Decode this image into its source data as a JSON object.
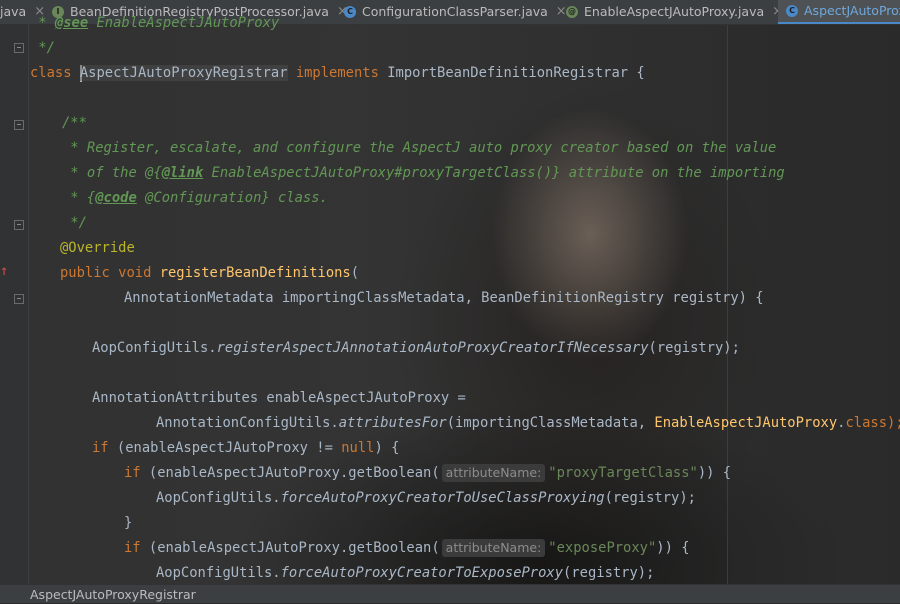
{
  "tabs": [
    {
      "label": "java",
      "icon": ""
    },
    {
      "label": "BeanDefinitionRegistryPostProcessor.java",
      "icon": "interface-icon",
      "icon_letter": "I",
      "icon_color": "#6a8759"
    },
    {
      "label": "ConfigurationClassParser.java",
      "icon": "class-icon",
      "icon_letter": "C",
      "icon_color": "#4a88c7"
    },
    {
      "label": "EnableAspectJAutoProxy.java",
      "icon": "annotation-icon",
      "icon_letter": "@",
      "icon_color": "#6a8759"
    },
    {
      "label": "AspectJAutoProx",
      "icon": "class-icon",
      "icon_letter": "C",
      "icon_color": "#4a88c7",
      "active": true
    }
  ],
  "close_glyph": "×",
  "code": {
    "l1_see": "@see",
    "l1_rest": " EnableAspectJAutoProxy",
    "l2": " */",
    "l3_class": "class ",
    "l3_name": "AspectJAutoProxyRegistrar",
    "l3_implements": " implements ",
    "l3_iface": "ImportBeanDefinitionRegistrar",
    "l3_brace": " {",
    "l4": "/**",
    "l5": " * Register, escalate, and configure the AspectJ auto proxy creator based on the value",
    "l6_a": " * of the @{",
    "l6_link": "@link",
    "l6_b": " EnableAspectJAutoProxy",
    "l6_c": "#proxyTargetClass()}",
    "l6_d": " attribute on the importing",
    "l7_a": " * {",
    "l7_code": "@code",
    "l7_b": " @Configuration} class.",
    "l8": " */",
    "l9": "@Override",
    "l10_mod": "public void ",
    "l10_fn": "registerBeanDefinitions",
    "l10_paren": "(",
    "l11": "AnnotationMetadata importingClassMetadata, BeanDefinitionRegistry registry) {",
    "l12_obj": "AopConfigUtils.",
    "l12_fn": "registerAspectJAnnotationAutoProxyCreatorIfNecessary",
    "l12_args": "(registry);",
    "l13": "AnnotationAttributes enableAspectJAutoProxy =",
    "l14_obj": "AnnotationConfigUtils.",
    "l14_fn": "attributesFor",
    "l14_args": "(importingClassMetadata, ",
    "l14_cls": "EnableAspectJAutoProxy",
    "l14_dot": ".",
    "l14_kw": "class",
    "l14_end": ");",
    "l15_if": "if",
    "l15_a": " (enableAspectJAutoProxy != ",
    "l15_null": "null",
    "l15_b": ") {",
    "l16_if": "if",
    "l16_a": " (enableAspectJAutoProxy.getBoolean(",
    "l16_hint": "attributeName:",
    "l16_str": "\"proxyTargetClass\"",
    "l16_b": ")) {",
    "l17_obj": "AopConfigUtils.",
    "l17_fn": "forceAutoProxyCreatorToUseClassProxying",
    "l17_args": "(registry);",
    "l18": "}",
    "l19_if": "if",
    "l19_a": " (enableAspectJAutoProxy.getBoolean(",
    "l19_hint": "attributeName:",
    "l19_str": "\"exposeProxy\"",
    "l19_b": ")) {",
    "l20_obj": "AopConfigUtils.",
    "l20_fn": "forceAutoProxyCreatorToExposeProxy",
    "l20_args": "(registry);"
  },
  "status": {
    "breadcrumb": "AspectJAutoProxyRegistrar"
  }
}
